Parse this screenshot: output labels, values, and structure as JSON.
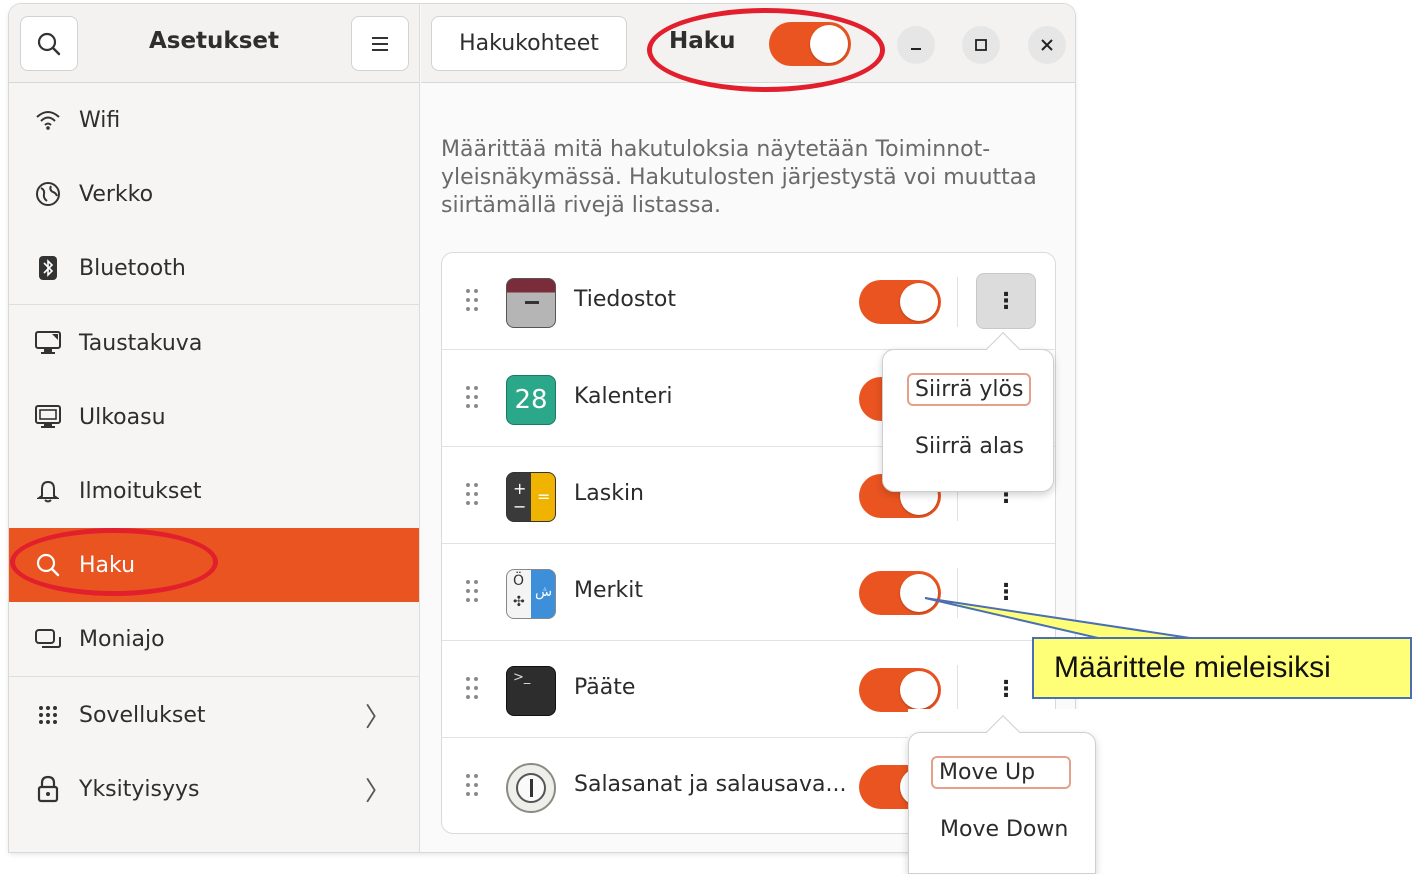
{
  "sidebar": {
    "title": "Asetukset",
    "items": [
      {
        "label": "Wifi",
        "icon": "wifi-icon"
      },
      {
        "label": "Verkko",
        "icon": "network-icon"
      },
      {
        "label": "Bluetooth",
        "icon": "bluetooth-icon"
      },
      {
        "label": "Taustakuva",
        "icon": "wallpaper-icon"
      },
      {
        "label": "Ulkoasu",
        "icon": "appearance-icon"
      },
      {
        "label": "Ilmoitukset",
        "icon": "bell-icon"
      },
      {
        "label": "Haku",
        "icon": "search-icon",
        "active": true
      },
      {
        "label": "Moniajo",
        "icon": "multitasking-icon"
      },
      {
        "label": "Sovellukset",
        "icon": "apps-grid-icon"
      },
      {
        "label": "Yksityisyys",
        "icon": "lock-icon"
      }
    ]
  },
  "header": {
    "tab_button": "Hakukohteet",
    "title": "Haku",
    "search_enabled": true
  },
  "description": {
    "line1": "Määrittää mitä hakutuloksia näytetään Toiminnot-",
    "line2": "yleisnäkymässä. Hakutulosten järjestystä voi muuttaa",
    "line3": "siirtämällä rivejä listassa."
  },
  "search_providers": [
    {
      "label": "Tiedostot",
      "enabled": true,
      "icon": "files-folder-icon"
    },
    {
      "label": "Kalenteri",
      "enabled": true,
      "icon": "calendar-icon",
      "icon_text": "28"
    },
    {
      "label": "Laskin",
      "enabled": true,
      "icon": "calculator-icon"
    },
    {
      "label": "Merkit",
      "enabled": true,
      "icon": "characters-icon"
    },
    {
      "label": "Pääte",
      "enabled": true,
      "icon": "terminal-icon"
    },
    {
      "label": "Salasanat ja salausava...",
      "enabled": true,
      "icon": "passwords-keys-icon"
    }
  ],
  "popover_fi": {
    "move_up": "Siirrä ylös",
    "move_down": "Siirrä alas"
  },
  "popover_en": {
    "move_up": "Move Up",
    "move_down": "Move Down"
  },
  "annotation": {
    "text": "Määrittele mieleisiksi"
  },
  "colors": {
    "accent": "#e95420",
    "annotation_ring": "#e2202d",
    "callout_bg": "#ffff77"
  }
}
